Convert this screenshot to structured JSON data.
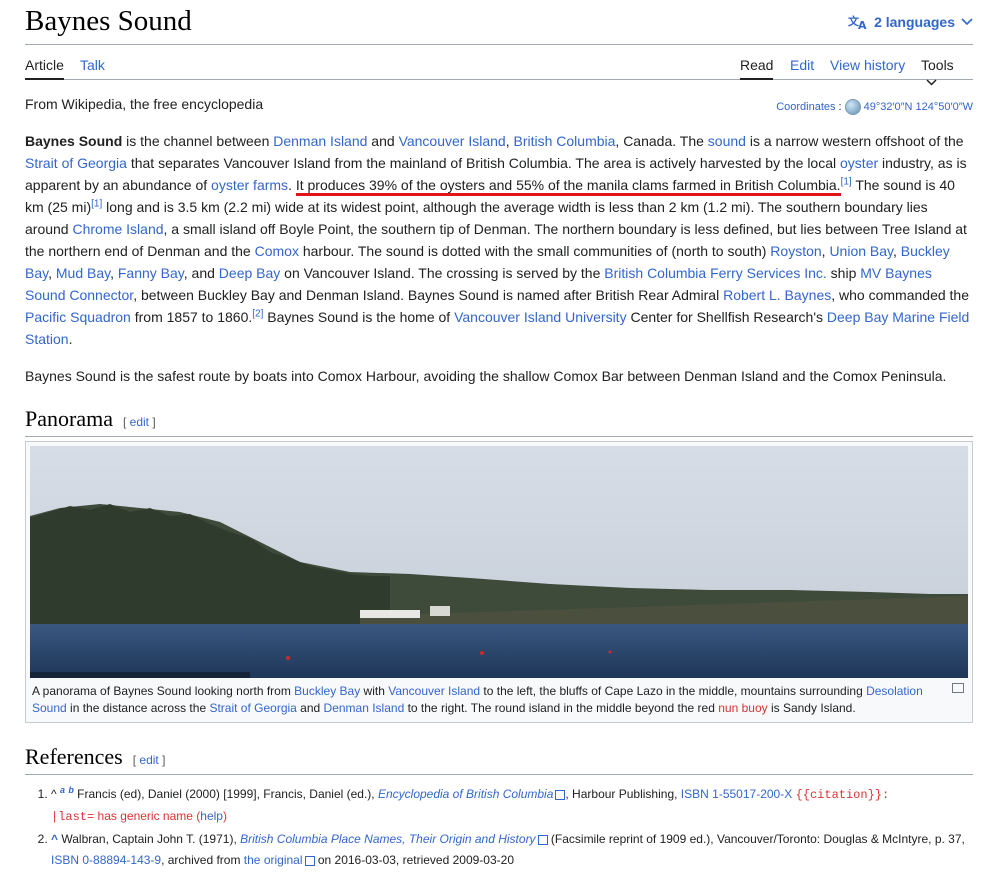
{
  "article": {
    "title": "Baynes Sound",
    "languages_label": "2 languages",
    "tagline": "From Wikipedia, the free encyclopedia",
    "coordinates_label": "Coordinates",
    "coordinates_value": "49°32′0″N 124°50′0″W"
  },
  "tabs": {
    "left": [
      "Article",
      "Talk"
    ],
    "right": [
      "Read",
      "Edit",
      "View history",
      "Tools"
    ]
  },
  "lead": {
    "b_title": "Baynes Sound",
    "t1": " is the channel between ",
    "l_denman": "Denman Island",
    "t2": " and ",
    "l_vi": "Vancouver Island",
    "t3": ", ",
    "l_bc": "British Columbia",
    "t4": ", Canada. The ",
    "l_sound": "sound",
    "t5": " is a narrow western offshoot of the ",
    "l_strait": "Strait of Georgia",
    "t6": " that separates Vancouver Island from the mainland of British Columbia. The area is actively harvested by the local ",
    "l_oyster": "oyster",
    "t7": " industry, as is apparent by an abundance of ",
    "l_oysterfarms": "oyster farms",
    "t8": ". ",
    "highlight": "It produces 39% of the oysters and 55% of the manila clams farmed in British Columbia.",
    "ref1": "[1]",
    "t9": " The sound is 40 km (25 mi)",
    "ref1b": "[1]",
    "t10": " long and is 3.5 km (2.2 mi) wide at its widest point, although the average width is less than 2 km (1.2 mi). The southern boundary lies around ",
    "l_chrome": "Chrome Island",
    "t11": ", a small island off Boyle Point, the southern tip of Denman. The northern boundary is less defined, but lies between Tree Island at the northern end of Denman and the ",
    "l_comox": "Comox",
    "t12": " harbour. The sound is dotted with the small communities of (north to south) ",
    "l_royston": "Royston",
    "t13": ", ",
    "l_union": "Union Bay",
    "t14": ", ",
    "l_buckley": "Buckley Bay",
    "t15": ", ",
    "l_mud": "Mud Bay",
    "t16": ", ",
    "l_fanny": "Fanny Bay",
    "t17": ", and ",
    "l_deep": "Deep Bay",
    "t18": " on Vancouver Island. The crossing is served by the ",
    "l_ferry": "British Columbia Ferry Services Inc.",
    "t19": " ship ",
    "l_mv": "MV Baynes Sound Connector",
    "t20": ", between Buckley Bay and Denman Island. Baynes Sound is named after British Rear Admiral ",
    "l_rlb": "Robert L. Baynes",
    "t21": ", who commanded the ",
    "l_pacific": "Pacific Squadron",
    "t22": " from 1857 to 1860.",
    "ref2": "[2]",
    "t23": " Baynes Sound is the home of ",
    "l_viu": "Vancouver Island University",
    "t24": " Center for Shellfish Research's ",
    "l_dbmfs": "Deep Bay Marine Field Station",
    "t25": "."
  },
  "para2": "Baynes Sound is the safest route by boats into Comox Harbour, avoiding the shallow Comox Bar between Denman Island and the Comox Peninsula.",
  "panorama": {
    "heading": "Panorama",
    "edit": "edit",
    "c1": "A panorama of Baynes Sound looking north from ",
    "c_buckley": "Buckley Bay",
    "c2": " with ",
    "c_vi": "Vancouver Island",
    "c3": " to the left, the bluffs of Cape Lazo in the middle, mountains surrounding ",
    "c_desolation": "Desolation Sound",
    "c4": " in the distance across the ",
    "c_strait": "Strait of Georgia",
    "c5": " and ",
    "c_denman": "Denman Island",
    "c6": " to the right. The round island in the middle beyond the red ",
    "c_nun": "nun buoy",
    "c7": " is Sandy Island."
  },
  "references": {
    "heading": "References",
    "edit": "edit",
    "r1_caret": "^",
    "r1_a": "a",
    "r1_b": "b",
    "r1_text1": " Francis (ed), Daniel (2000) [1999], Francis, Daniel (ed.), ",
    "r1_book": "Encyclopedia of British Columbia",
    "r1_text2": ", Harbour Publishing, ",
    "r1_isbn_label": "ISBN",
    "r1_isbn": "1-55017-200-X",
    "r1_err1": "{{citation}}",
    "r1_err1b": ":",
    "r1_err2": "|last=",
    "r1_err3": " has generic name (",
    "r1_help": "help",
    "r1_err4": ")",
    "r2_caret": "^",
    "r2_text1": " Walbran, Captain John T. (1971), ",
    "r2_book": "British Columbia Place Names, Their Origin and History",
    "r2_text2": " (Facsimile reprint of 1909 ed.), Vancouver/Toronto: Douglas & McIntyre, p. 37, ",
    "r2_isbn_label": "ISBN",
    "r2_isbn": "0-88894-143-9",
    "r2_text3": ", archived from ",
    "r2_orig": "the original",
    "r2_text4": " on 2016-03-03, retrieved 2009-03-20"
  }
}
